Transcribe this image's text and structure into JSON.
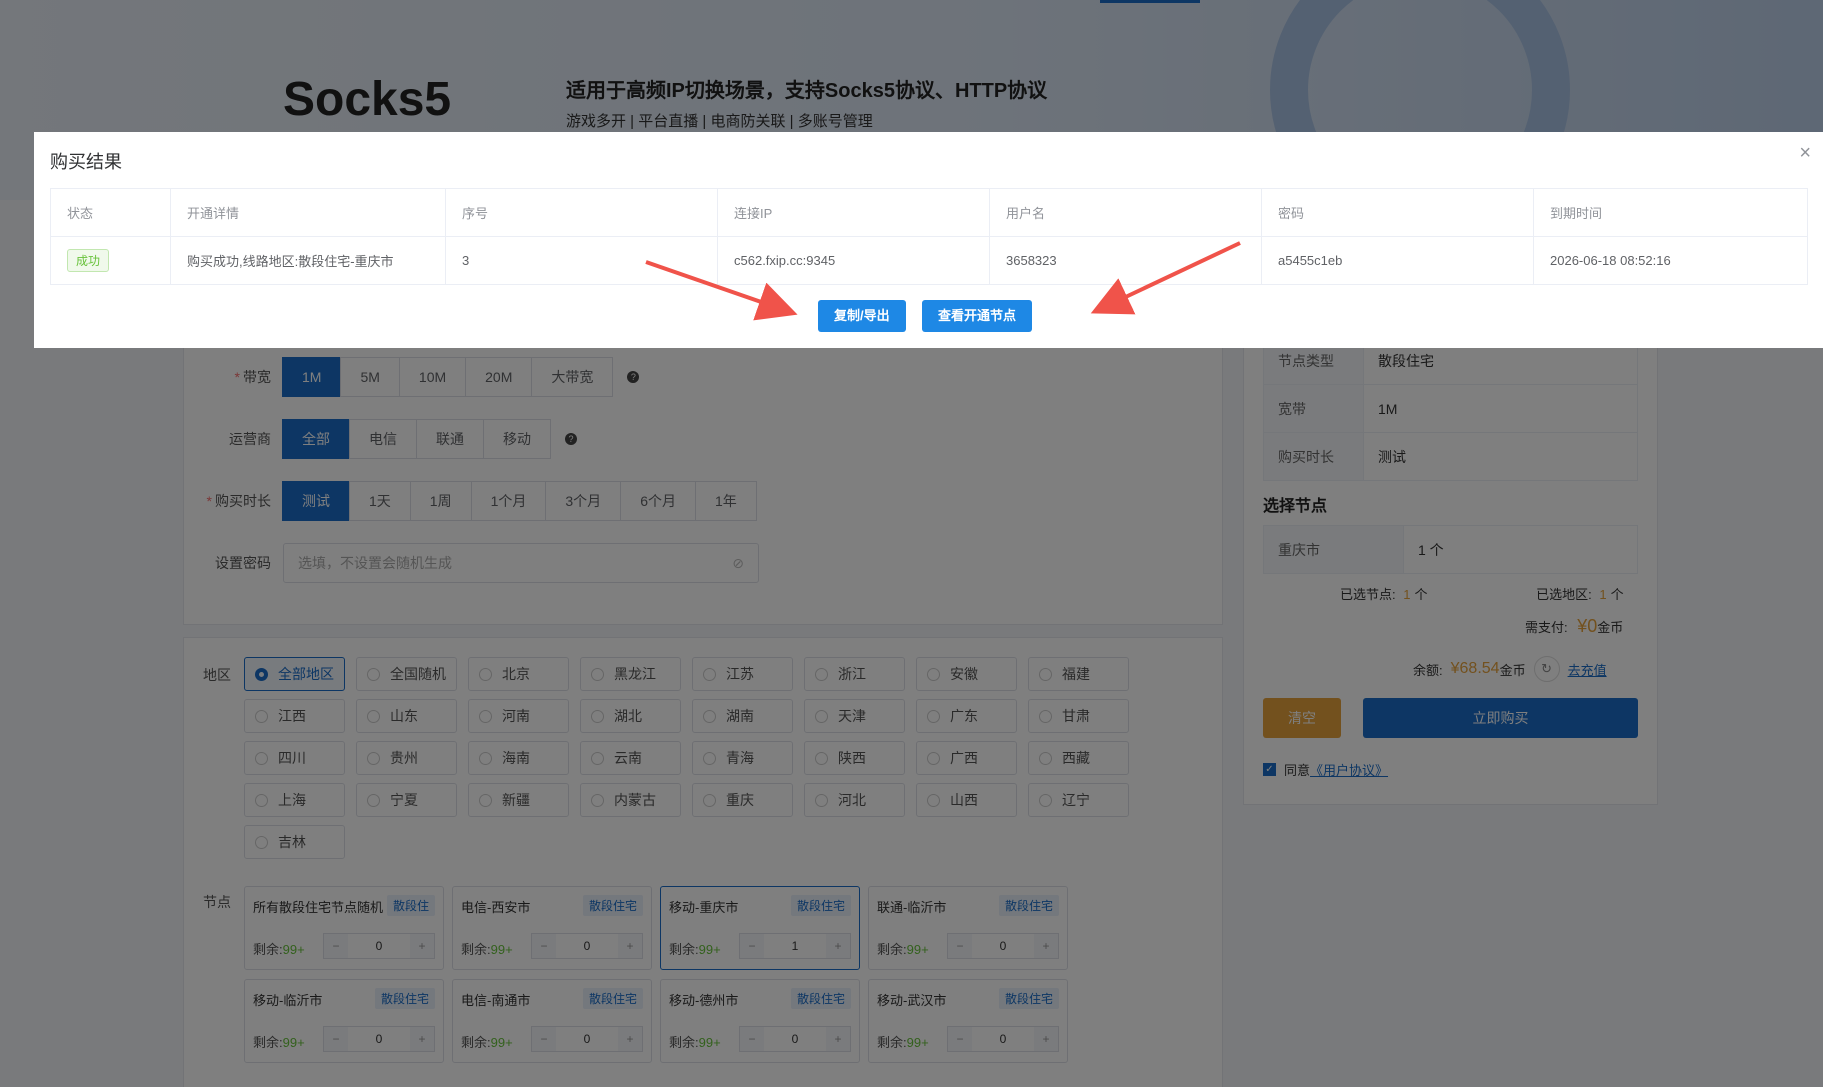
{
  "banner": {
    "brand": "Socks5",
    "headline": "适用于高频IP切换场景，支持Socks5协议、HTTP协议",
    "subline": "游戏多开 | 平台直播 | 电商防关联 | 多账号管理"
  },
  "form": {
    "bandwidth": {
      "label": "带宽",
      "options": [
        "1M",
        "5M",
        "10M",
        "20M",
        "大带宽"
      ],
      "selected": "1M"
    },
    "carrier": {
      "label": "运营商",
      "options": [
        "全部",
        "电信",
        "联通",
        "移动"
      ],
      "selected": "全部"
    },
    "duration": {
      "label": "购买时长",
      "options": [
        "测试",
        "1天",
        "1周",
        "1个月",
        "3个月",
        "6个月",
        "1年"
      ],
      "selected": "测试"
    },
    "password": {
      "label": "设置密码",
      "placeholder": "选填，不设置会随机生成"
    }
  },
  "region": {
    "label": "地区",
    "items": [
      "全部地区",
      "全国随机",
      "北京",
      "黑龙江",
      "江苏",
      "浙江",
      "安徽",
      "福建",
      "江西",
      "山东",
      "河南",
      "湖北",
      "湖南",
      "天津",
      "广东",
      "甘肃",
      "四川",
      "贵州",
      "海南",
      "云南",
      "青海",
      "陕西",
      "广西",
      "西藏",
      "上海",
      "宁夏",
      "新疆",
      "内蒙古",
      "重庆",
      "河北",
      "山西",
      "辽宁",
      "吉林"
    ],
    "selected": "全部地区"
  },
  "nodes": {
    "label": "节点",
    "rest_label": "剩余:",
    "items": [
      {
        "name": "所有散段住宅节点随机",
        "tag": "散段住",
        "rest": "99+",
        "qty": "0"
      },
      {
        "name": "电信-西安市",
        "tag": "散段住宅",
        "rest": "99+",
        "qty": "0"
      },
      {
        "name": "移动-重庆市",
        "tag": "散段住宅",
        "rest": "99+",
        "qty": "1"
      },
      {
        "name": "联通-临沂市",
        "tag": "散段住宅",
        "rest": "99+",
        "qty": "0"
      },
      {
        "name": "移动-临沂市",
        "tag": "散段住宅",
        "rest": "99+",
        "qty": "0"
      },
      {
        "name": "电信-南通市",
        "tag": "散段住宅",
        "rest": "99+",
        "qty": "0"
      },
      {
        "name": "移动-德州市",
        "tag": "散段住宅",
        "rest": "99+",
        "qty": "0"
      },
      {
        "name": "移动-武汉市",
        "tag": "散段住宅",
        "rest": "99+",
        "qty": "0"
      }
    ]
  },
  "summary": {
    "rows": [
      {
        "k": "节点类型",
        "v": "散段住宅"
      },
      {
        "k": "宽带",
        "v": "1M"
      },
      {
        "k": "购买时长",
        "v": "测试"
      }
    ],
    "select_title": "选择节点",
    "selected_node": {
      "k": "重庆市",
      "v": "1 个"
    },
    "selected_nodes_label": "已选节点:",
    "selected_nodes_value": "1",
    "selected_regions_label": "已选地区:",
    "selected_regions_value": "1",
    "unit": "个",
    "pay_label": "需支付:",
    "pay_value": "¥0",
    "coin": "金币",
    "balance_label": "余额:",
    "balance_value": "¥68.54",
    "recharge": "去充值",
    "clear_btn": "清空",
    "buy_btn": "立即购买",
    "agree_text": "同意",
    "agreement": "《用户协议》"
  },
  "dialog": {
    "title": "购买结果",
    "close": "×",
    "columns": [
      "状态",
      "开通详情",
      "序号",
      "连接IP",
      "用户名",
      "密码",
      "到期时间"
    ],
    "row": {
      "status": "成功",
      "detail": "购买成功,线路地区:散段住宅-重庆市",
      "index": "3",
      "ip": "c562.fxip.cc:9345",
      "username": "3658323",
      "password": "a5455c1eb",
      "expire": "2026-06-18 08:52:16"
    },
    "copy_btn": "复制/导出",
    "view_btn": "查看开通节点"
  },
  "colors": {
    "primary": "#1a6dc8",
    "success": "#67c23a",
    "orange": "#e6a23c",
    "arrow": "#f0534a"
  }
}
